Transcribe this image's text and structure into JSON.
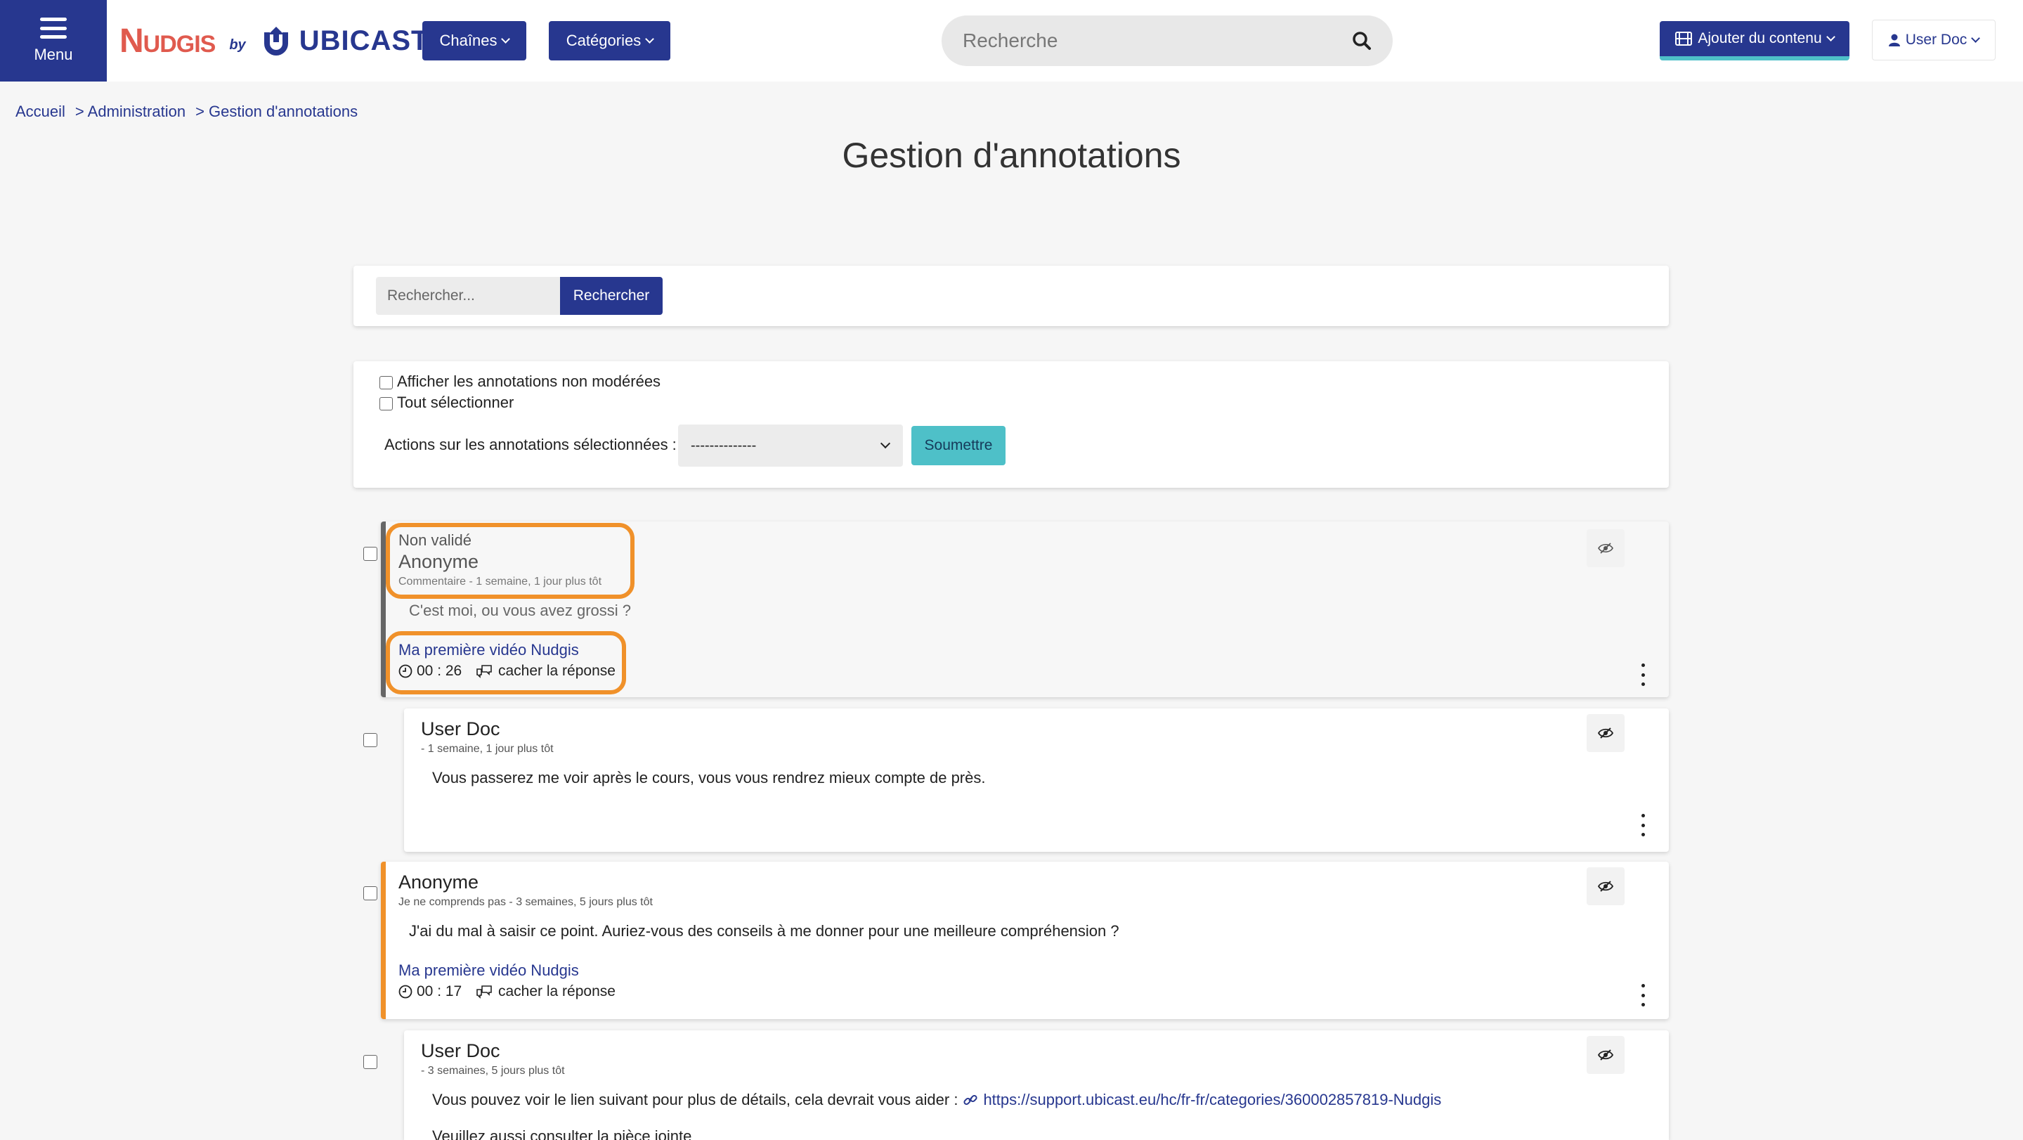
{
  "header": {
    "menu_label": "Menu",
    "logo": {
      "brand": "Nudgis",
      "by": "by",
      "company": "UBICAST"
    },
    "nav": {
      "channels_label": "Chaînes",
      "categories_label": "Catégories"
    },
    "search": {
      "placeholder": "Recherche"
    },
    "add_content_label": "Ajouter du contenu",
    "user_label": "User Doc"
  },
  "breadcrumb": {
    "home": "Accueil",
    "admin": "> Administration",
    "current": "> Gestion d'annotations"
  },
  "page_title": "Gestion d'annotations",
  "filter": {
    "placeholder": "Rechercher...",
    "button_label": "Rechercher"
  },
  "actions": {
    "show_unmoderated_label": "Afficher les annotations non modérées",
    "select_all_label": "Tout sélectionner",
    "actions_label": "Actions sur les annotations sélectionnées :",
    "select_value": "--------------",
    "submit_label": "Soumettre"
  },
  "annotations": [
    {
      "status": "Non validé",
      "author": "Anonyme",
      "meta": "Commentaire - 1 semaine, 1 jour plus tôt",
      "content": "C'est moi, ou vous avez grossi ?",
      "media_title": "Ma première vidéo Nudgis",
      "timecode": "00 : 26",
      "reply_label": "cacher la réponse"
    },
    {
      "author": "User Doc",
      "meta": "- 1 semaine, 1 jour plus tôt",
      "content": "Vous passerez me voir après le cours, vous vous rendrez mieux compte de près."
    },
    {
      "author": "Anonyme",
      "meta": "Je ne comprends pas - 3 semaines, 5 jours plus tôt",
      "content": "J'ai du mal à saisir ce point. Auriez-vous des conseils à me donner pour une meilleure compréhension ?",
      "media_title": "Ma première vidéo Nudgis",
      "timecode": "00 : 17",
      "reply_label": "cacher la réponse"
    },
    {
      "author": "User Doc",
      "meta": "- 3 semaines, 5 jours plus tôt",
      "content": "Vous pouvez voir le lien suivant pour plus de détails, cela devrait vous aider :",
      "link": "https://support.ubicast.eu/hc/fr-fr/categories/360002857819-Nudgis",
      "content_2": "Veuillez aussi consulter la pièce jointe"
    }
  ],
  "colors": {
    "primary": "#27378f",
    "accent": "#4ec0c8",
    "brand_red": "#e05a4e",
    "highlight": "#f0912a",
    "unvalidated_bar": "#666666"
  },
  "icons": {
    "menu": "hamburger-icon",
    "search": "search-icon",
    "add": "film-icon",
    "user": "user-icon",
    "eye": "eye-slash-icon",
    "more": "kebab-icon",
    "clock": "clock-icon",
    "reply": "comments-icon",
    "link": "link-icon"
  }
}
